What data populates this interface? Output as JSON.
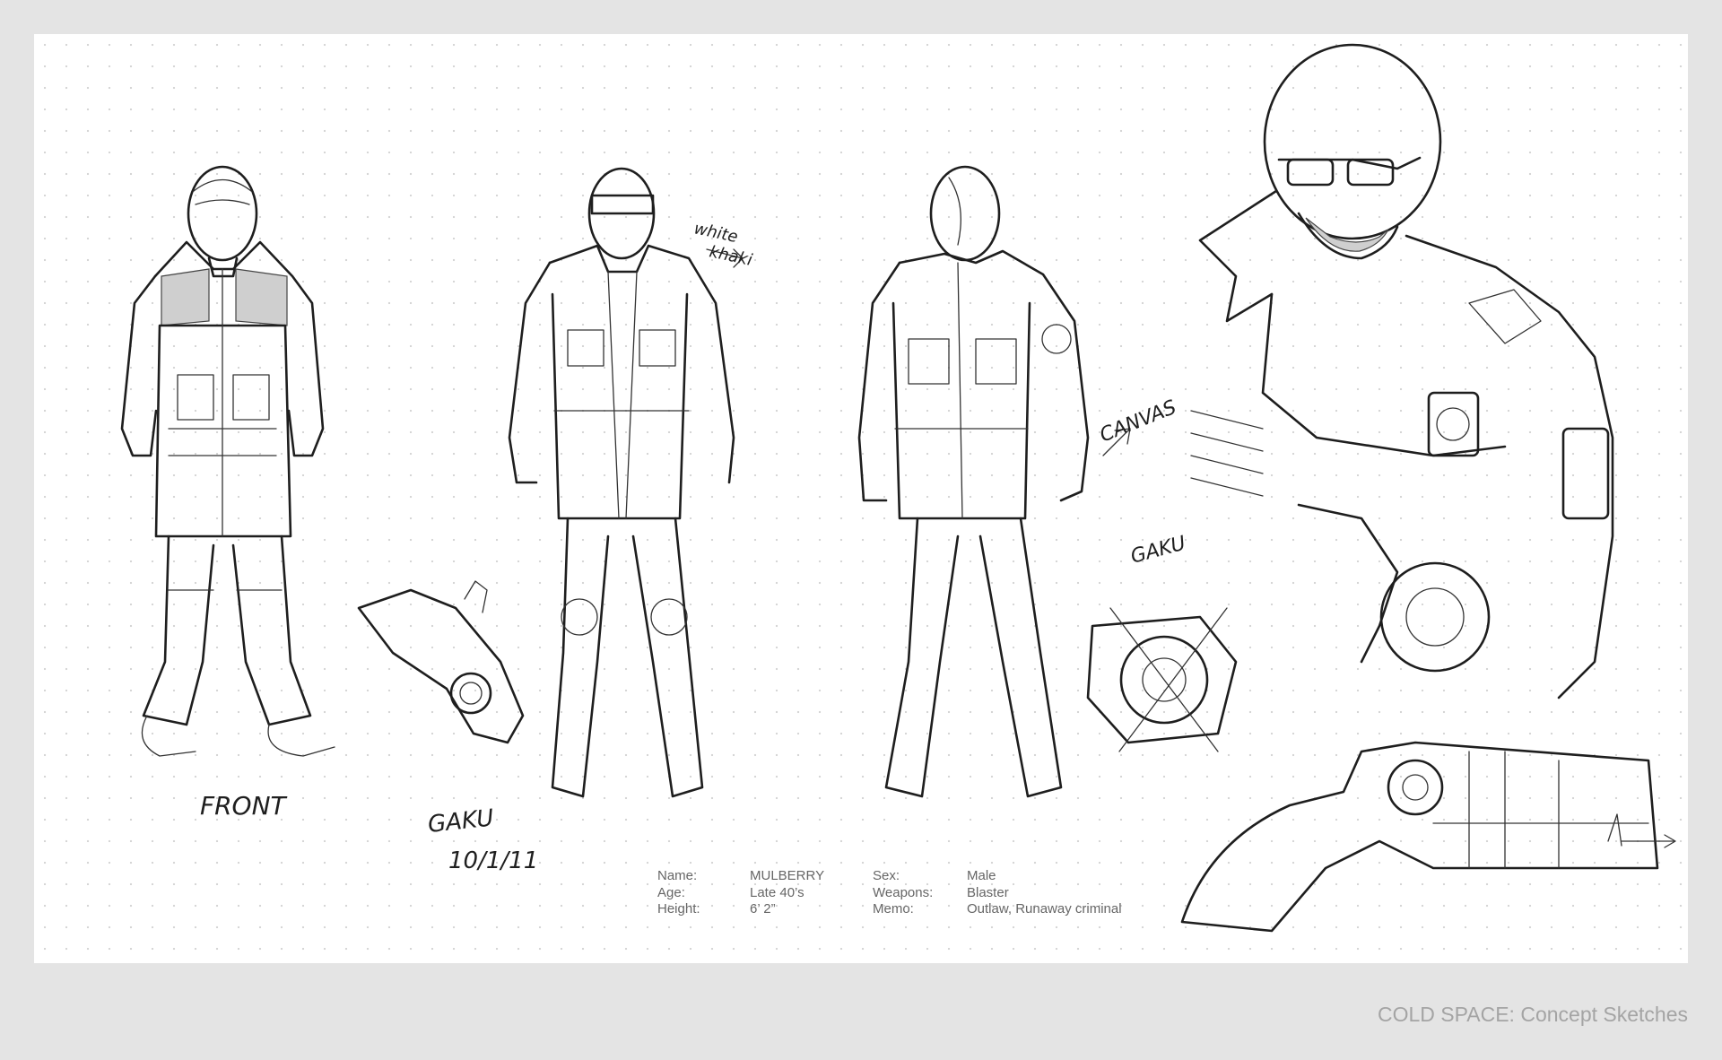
{
  "caption": "COLD SPACE: Concept Sketches",
  "sheet_notes": {
    "front": "FRONT",
    "white_khaki_1": "white",
    "white_khaki_2": "khaki",
    "canvas": "CANVAS",
    "signature": "GAKU",
    "date": "10/1/11",
    "gaku": "GAKU"
  },
  "character_sheet": {
    "name_label": "Name:",
    "name_value": "MULBERRY",
    "age_label": "Age:",
    "age_value": "Late 40’s",
    "height_label": "Height:",
    "height_value": "6’ 2”",
    "sex_label": "Sex:",
    "sex_value": "Male",
    "weapons_label": "Weapons:",
    "weapons_value": "Blaster",
    "memo_label": "Memo:",
    "memo_value": "Outlaw, Runaway criminal"
  },
  "figures": [
    {
      "icon": "front-view-figure-icon"
    },
    {
      "icon": "coat-figure-icon"
    },
    {
      "icon": "three-quarter-figure-icon"
    },
    {
      "icon": "bust-closeup-icon"
    },
    {
      "icon": "blaster-pistol-icon"
    }
  ],
  "colors": {
    "page": "#e4e4e4",
    "sheet": "#ffffff",
    "caption": "#a4a4a4",
    "stats": "#666666",
    "ink": "#1e1e1e"
  }
}
